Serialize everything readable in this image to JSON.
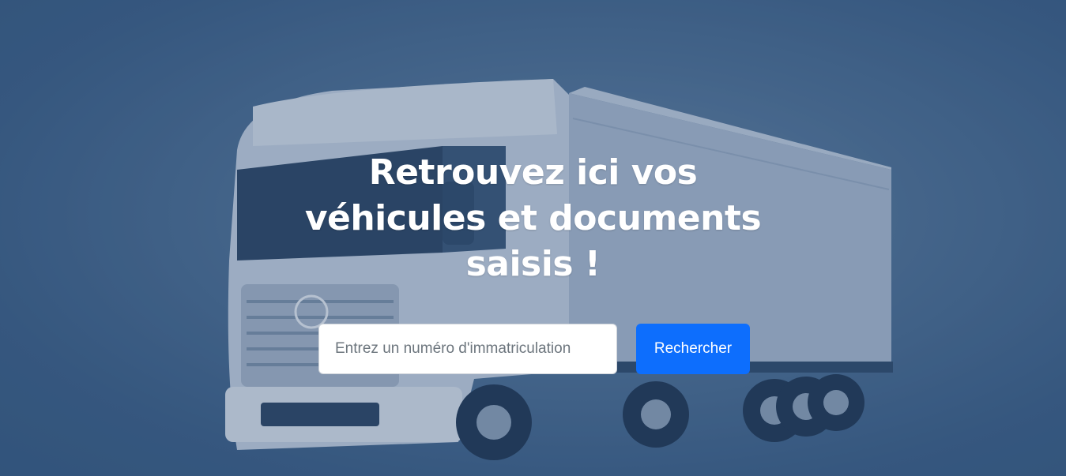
{
  "hero": {
    "headline_lines": [
      "Retrouvez ici vos",
      "véhicules et documents",
      "saisis !"
    ]
  },
  "search": {
    "placeholder": "Entrez un numéro d'immatriculation",
    "button_label": "Rechercher"
  },
  "colors": {
    "background": "#3f6389",
    "button": "#0d6efd",
    "text": "#ffffff"
  }
}
